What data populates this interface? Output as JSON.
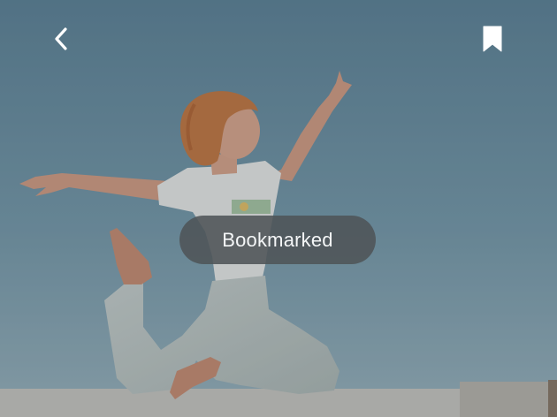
{
  "header": {
    "back_icon": "chevron-left-icon",
    "bookmark_icon": "bookmark-filled-icon"
  },
  "toast": {
    "message": "Bookmarked"
  },
  "colors": {
    "sky": "#6f93a6",
    "toast_bg": "#4e5458",
    "icon": "#ffffff"
  }
}
